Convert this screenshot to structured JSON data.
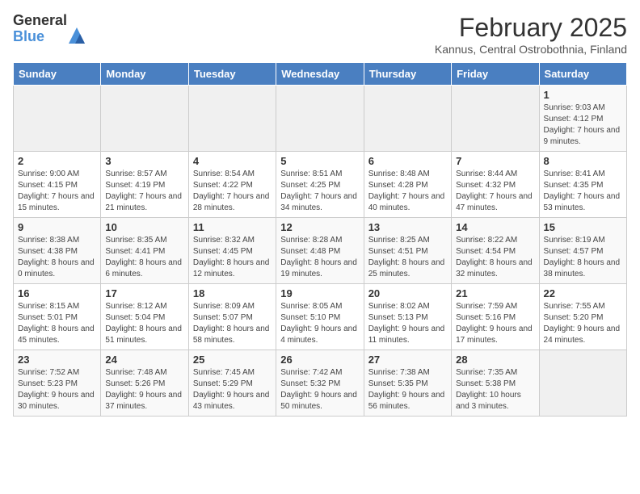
{
  "logo": {
    "general": "General",
    "blue": "Blue"
  },
  "title": "February 2025",
  "subtitle": "Kannus, Central Ostrobothnia, Finland",
  "weekdays": [
    "Sunday",
    "Monday",
    "Tuesday",
    "Wednesday",
    "Thursday",
    "Friday",
    "Saturday"
  ],
  "weeks": [
    [
      {
        "day": "",
        "info": ""
      },
      {
        "day": "",
        "info": ""
      },
      {
        "day": "",
        "info": ""
      },
      {
        "day": "",
        "info": ""
      },
      {
        "day": "",
        "info": ""
      },
      {
        "day": "",
        "info": ""
      },
      {
        "day": "1",
        "info": "Sunrise: 9:03 AM\nSunset: 4:12 PM\nDaylight: 7 hours and 9 minutes."
      }
    ],
    [
      {
        "day": "2",
        "info": "Sunrise: 9:00 AM\nSunset: 4:15 PM\nDaylight: 7 hours and 15 minutes."
      },
      {
        "day": "3",
        "info": "Sunrise: 8:57 AM\nSunset: 4:19 PM\nDaylight: 7 hours and 21 minutes."
      },
      {
        "day": "4",
        "info": "Sunrise: 8:54 AM\nSunset: 4:22 PM\nDaylight: 7 hours and 28 minutes."
      },
      {
        "day": "5",
        "info": "Sunrise: 8:51 AM\nSunset: 4:25 PM\nDaylight: 7 hours and 34 minutes."
      },
      {
        "day": "6",
        "info": "Sunrise: 8:48 AM\nSunset: 4:28 PM\nDaylight: 7 hours and 40 minutes."
      },
      {
        "day": "7",
        "info": "Sunrise: 8:44 AM\nSunset: 4:32 PM\nDaylight: 7 hours and 47 minutes."
      },
      {
        "day": "8",
        "info": "Sunrise: 8:41 AM\nSunset: 4:35 PM\nDaylight: 7 hours and 53 minutes."
      }
    ],
    [
      {
        "day": "9",
        "info": "Sunrise: 8:38 AM\nSunset: 4:38 PM\nDaylight: 8 hours and 0 minutes."
      },
      {
        "day": "10",
        "info": "Sunrise: 8:35 AM\nSunset: 4:41 PM\nDaylight: 8 hours and 6 minutes."
      },
      {
        "day": "11",
        "info": "Sunrise: 8:32 AM\nSunset: 4:45 PM\nDaylight: 8 hours and 12 minutes."
      },
      {
        "day": "12",
        "info": "Sunrise: 8:28 AM\nSunset: 4:48 PM\nDaylight: 8 hours and 19 minutes."
      },
      {
        "day": "13",
        "info": "Sunrise: 8:25 AM\nSunset: 4:51 PM\nDaylight: 8 hours and 25 minutes."
      },
      {
        "day": "14",
        "info": "Sunrise: 8:22 AM\nSunset: 4:54 PM\nDaylight: 8 hours and 32 minutes."
      },
      {
        "day": "15",
        "info": "Sunrise: 8:19 AM\nSunset: 4:57 PM\nDaylight: 8 hours and 38 minutes."
      }
    ],
    [
      {
        "day": "16",
        "info": "Sunrise: 8:15 AM\nSunset: 5:01 PM\nDaylight: 8 hours and 45 minutes."
      },
      {
        "day": "17",
        "info": "Sunrise: 8:12 AM\nSunset: 5:04 PM\nDaylight: 8 hours and 51 minutes."
      },
      {
        "day": "18",
        "info": "Sunrise: 8:09 AM\nSunset: 5:07 PM\nDaylight: 8 hours and 58 minutes."
      },
      {
        "day": "19",
        "info": "Sunrise: 8:05 AM\nSunset: 5:10 PM\nDaylight: 9 hours and 4 minutes."
      },
      {
        "day": "20",
        "info": "Sunrise: 8:02 AM\nSunset: 5:13 PM\nDaylight: 9 hours and 11 minutes."
      },
      {
        "day": "21",
        "info": "Sunrise: 7:59 AM\nSunset: 5:16 PM\nDaylight: 9 hours and 17 minutes."
      },
      {
        "day": "22",
        "info": "Sunrise: 7:55 AM\nSunset: 5:20 PM\nDaylight: 9 hours and 24 minutes."
      }
    ],
    [
      {
        "day": "23",
        "info": "Sunrise: 7:52 AM\nSunset: 5:23 PM\nDaylight: 9 hours and 30 minutes."
      },
      {
        "day": "24",
        "info": "Sunrise: 7:48 AM\nSunset: 5:26 PM\nDaylight: 9 hours and 37 minutes."
      },
      {
        "day": "25",
        "info": "Sunrise: 7:45 AM\nSunset: 5:29 PM\nDaylight: 9 hours and 43 minutes."
      },
      {
        "day": "26",
        "info": "Sunrise: 7:42 AM\nSunset: 5:32 PM\nDaylight: 9 hours and 50 minutes."
      },
      {
        "day": "27",
        "info": "Sunrise: 7:38 AM\nSunset: 5:35 PM\nDaylight: 9 hours and 56 minutes."
      },
      {
        "day": "28",
        "info": "Sunrise: 7:35 AM\nSunset: 5:38 PM\nDaylight: 10 hours and 3 minutes."
      },
      {
        "day": "",
        "info": ""
      }
    ]
  ]
}
